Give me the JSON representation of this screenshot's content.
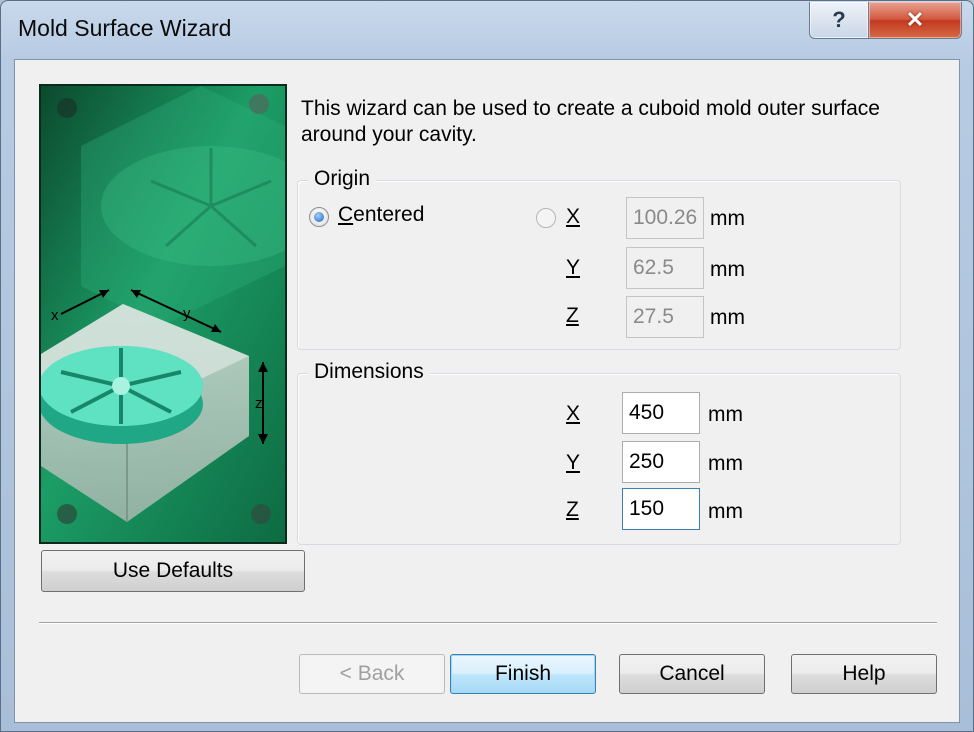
{
  "window": {
    "title": "Mold Surface Wizard",
    "help_glyph": "?",
    "close_glyph": "✕"
  },
  "intro": "This wizard can be used to create a cuboid mold outer surface around your cavity.",
  "origin": {
    "legend": "Origin",
    "centered_label": "Centered",
    "centered_selected": true,
    "x_label": "X",
    "y_label": "Y",
    "z_label": "Z",
    "x_value": "100.26",
    "y_value": "62.5",
    "z_value": "27.5",
    "unit": "mm"
  },
  "dimensions": {
    "legend": "Dimensions",
    "x_label": "X",
    "y_label": "Y",
    "z_label": "Z",
    "x_value": "450",
    "y_value": "250",
    "z_value": "150",
    "unit": "mm"
  },
  "illustration": {
    "axis_x": "x",
    "axis_y": "y",
    "axis_z": "z"
  },
  "buttons": {
    "use_defaults": "Use Defaults",
    "back": "< Back",
    "finish": "Finish",
    "cancel": "Cancel",
    "help": "Help"
  },
  "colors": {
    "panel_green": "#1a9a63",
    "cavity_teal": "#3fd7b4",
    "default_button_border": "#3c7fb1"
  }
}
